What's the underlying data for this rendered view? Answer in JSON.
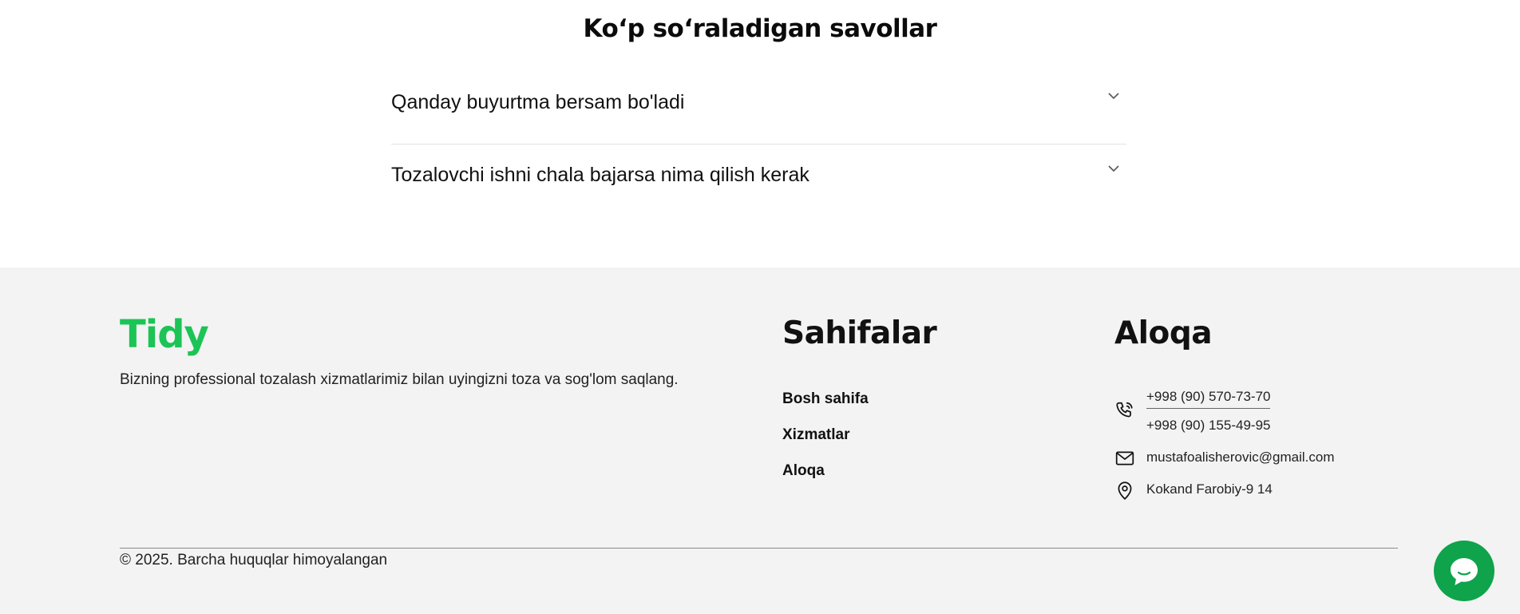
{
  "faq": {
    "title": "Ko‘p so‘raladigan savollar",
    "items": [
      {
        "question": "Qanday buyurtma bersam bo'ladi",
        "icon": "chevron-down-icon"
      },
      {
        "question": "Tozalovchi ishni chala bajarsa nima qilish kerak",
        "icon": "chevron-down-icon"
      }
    ]
  },
  "footer": {
    "brand": "Tidy",
    "brand_color": "#1cc455",
    "description": "Bizning professional tozalash xizmatlarimiz bilan uyingizni toza va sog'lom saqlang.",
    "pages": {
      "title": "Sahifalar",
      "links": [
        "Bosh sahifa",
        "Xizmatlar",
        "Aloqa"
      ]
    },
    "contact": {
      "title": "Aloqa",
      "phones": [
        "+998 (90) 570-73-70",
        "+998 (90) 155-49-95"
      ],
      "phone_icon": "phone-icon",
      "email": "mustafoalisherovic@gmail.com",
      "email_icon": "mail-icon",
      "address": "Kokand Farobiy-9 14",
      "address_icon": "map-pin-icon"
    },
    "copyright": "© 2025. Barcha huquqlar himoyalangan"
  },
  "chat": {
    "icon": "chat-bubble-icon",
    "color": "#0fa34c"
  }
}
